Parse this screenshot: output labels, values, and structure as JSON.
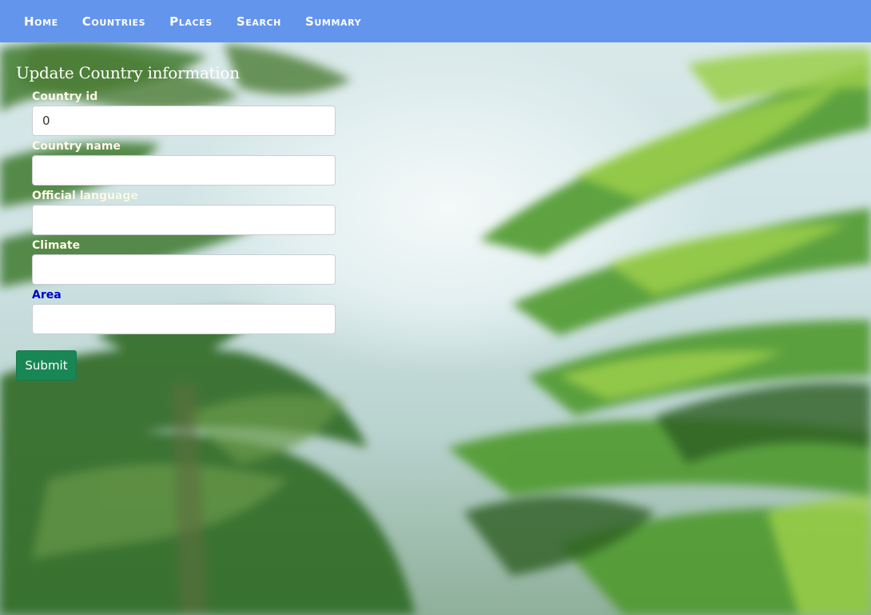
{
  "nav": {
    "items": [
      {
        "label": "Home"
      },
      {
        "label": "Countries"
      },
      {
        "label": "Places"
      },
      {
        "label": "Search"
      },
      {
        "label": "Summary"
      }
    ]
  },
  "form": {
    "title": "Update Country information",
    "fields": [
      {
        "label": "Country id",
        "value": "0",
        "placeholder": ""
      },
      {
        "label": "Country name",
        "value": "",
        "placeholder": ""
      },
      {
        "label": "Official language",
        "value": "",
        "placeholder": ""
      },
      {
        "label": "Climate",
        "value": "",
        "placeholder": ""
      },
      {
        "label": "Area",
        "value": "",
        "placeholder": ""
      }
    ],
    "submit_label": "Submit"
  },
  "colors": {
    "navbar": "#6495ed",
    "submit": "#198754",
    "area_label": "#0000cd"
  }
}
